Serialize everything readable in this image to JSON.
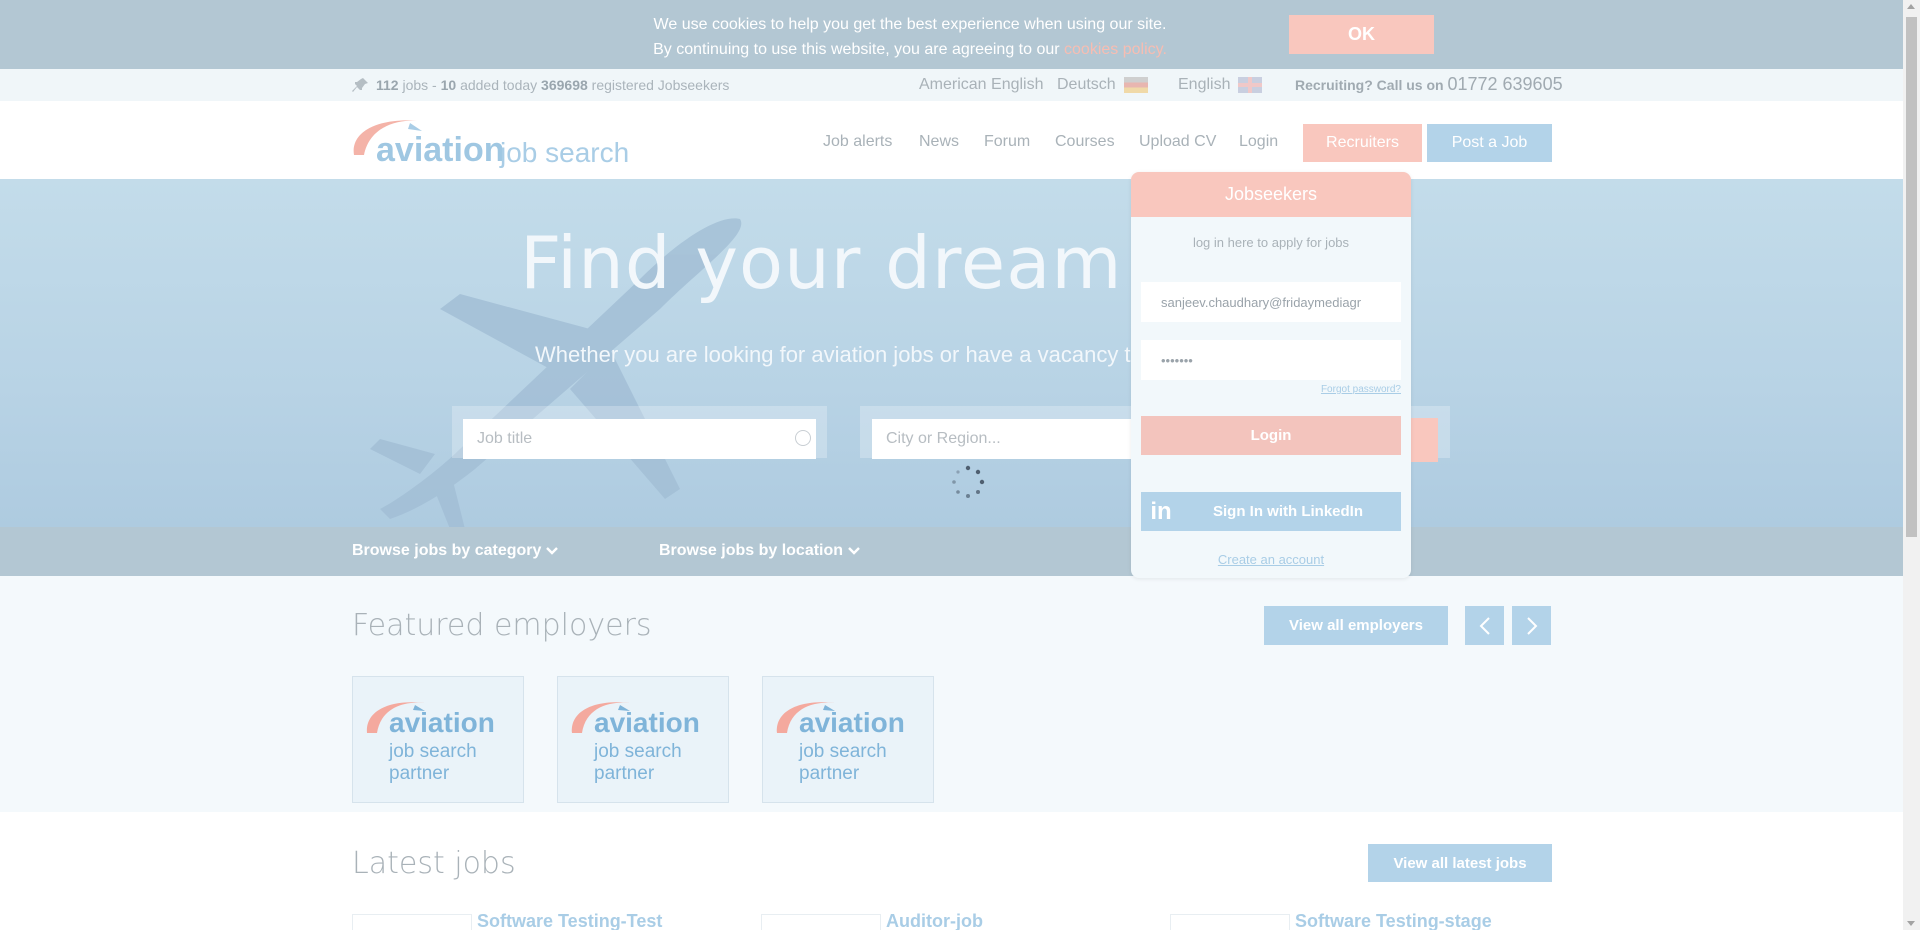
{
  "cookie": {
    "line1": "We use cookies to help you get the best experience when using our site.",
    "line2_prefix": "By continuing to use this website, you are agreeing to our ",
    "link": "cookies policy.",
    "ok": "OK"
  },
  "topbar": {
    "jobs_count": "112",
    "jobs_label": "jobs -",
    "added_count": "10",
    "added_label": "added today",
    "registered_count": "369698",
    "registered_label": "registered Jobseekers",
    "lang_us": "American English",
    "lang_de": "Deutsch",
    "lang_en": "English",
    "recruiting_label": "Recruiting? Call us on",
    "phone": "01772 639605"
  },
  "header": {
    "logo_word": "aviation",
    "logo_sub": "job search",
    "nav": [
      "Job alerts",
      "News",
      "Forum",
      "Courses",
      "Upload CV",
      "Login"
    ],
    "recruiters": "Recruiters",
    "post_job": "Post a Job"
  },
  "hero": {
    "title": "Find your dream avia",
    "subtitle": "Whether you are looking for aviation jobs or have a vacancy to",
    "job_placeholder": "Job title",
    "location_placeholder": "City or Region..."
  },
  "browse": {
    "category": "Browse jobs by category",
    "location": "Browse jobs by location"
  },
  "featured": {
    "title": "Featured employers",
    "view_all": "View all employers",
    "card_word": "aviation",
    "card_sub1": "job search",
    "card_sub2": "partner"
  },
  "latest": {
    "title": "Latest jobs",
    "view_all": "View all latest jobs",
    "jobs": [
      "Software Testing-Test",
      "Auditor-job",
      "Software Testing-stage"
    ]
  },
  "login": {
    "heading": "Jobseekers",
    "caption": "log in here to apply for jobs",
    "email": "sanjeev.chaudhary@fridaymediagr",
    "password": "•••••••",
    "forgot": "Forgot password?",
    "login_btn": "Login",
    "linkedin_btn": "Sign In with LinkedIn",
    "create": "Create an account"
  },
  "colors": {
    "accent_pink": "#f9c7be",
    "accent_blue": "#b3d3e9",
    "bar_gray": "#b3c7d3"
  }
}
